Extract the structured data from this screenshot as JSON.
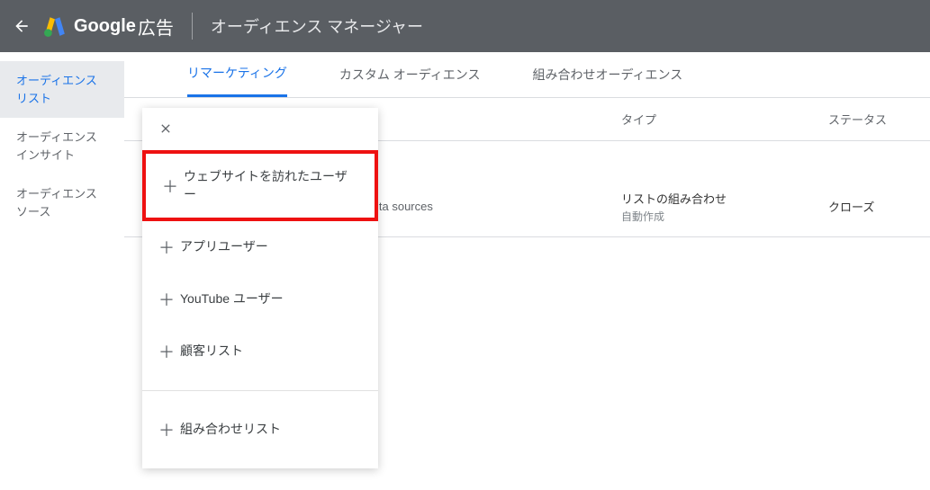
{
  "header": {
    "brand_bold": "Google",
    "brand_rest": " 広告",
    "title": "オーディエンス マネージャー"
  },
  "sidebar": {
    "items": [
      {
        "label": "オーディエンス リスト",
        "active": true
      },
      {
        "label": "オーディエンス インサイト",
        "active": false
      },
      {
        "label": "オーディエンス ソース",
        "active": false
      }
    ]
  },
  "tabs": [
    {
      "label": "リマーケティング",
      "active": true
    },
    {
      "label": "カスタム オーディエンス",
      "active": false
    },
    {
      "label": "組み合わせオーディエンス",
      "active": false
    }
  ],
  "table": {
    "headers": {
      "type": "タイプ",
      "status": "ステータス"
    },
    "rows": [
      {
        "source_fragment": "ita sources",
        "type_main": "リストの組み合わせ",
        "type_sub": "自動作成",
        "status": "クローズ"
      }
    ]
  },
  "dropdown": {
    "items": [
      {
        "label": "ウェブサイトを訪れたユーザー",
        "highlight": true
      },
      {
        "label": "アプリユーザー",
        "highlight": false
      },
      {
        "label": "YouTube ユーザー",
        "highlight": false
      },
      {
        "label": "顧客リスト",
        "highlight": false
      }
    ],
    "sep_after_index": 3,
    "extra": {
      "label": "組み合わせリスト"
    }
  }
}
